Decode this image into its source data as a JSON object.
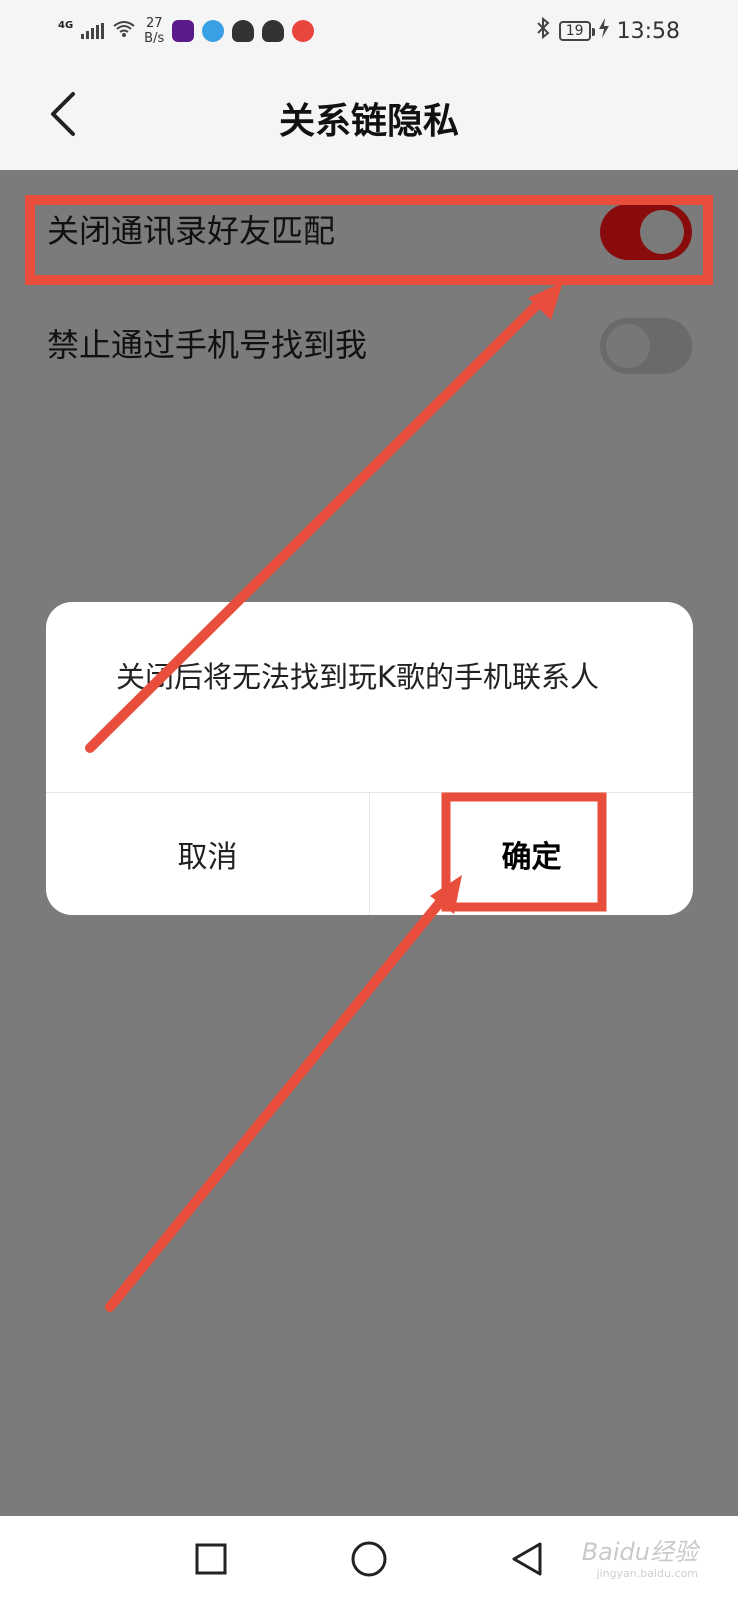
{
  "status_bar": {
    "network": "4G",
    "speed": "27\nB/s",
    "battery": "19",
    "time": "13:58"
  },
  "header": {
    "title": "关系链隐私"
  },
  "settings": [
    {
      "label": "关闭通讯录好友匹配",
      "enabled": true
    },
    {
      "label": "禁止通过手机号找到我",
      "enabled": false
    }
  ],
  "dialog": {
    "message": "关闭后将无法找到玩K歌的手机联系人",
    "cancel_label": "取消",
    "confirm_label": "确定"
  },
  "watermark": {
    "text": "Baidu经验",
    "sub": "jingyan.baidu.com"
  },
  "colors": {
    "annotation": "#e94e3c",
    "toggle_on": "#8a0b0b",
    "overlay": "#7b7b7b"
  }
}
